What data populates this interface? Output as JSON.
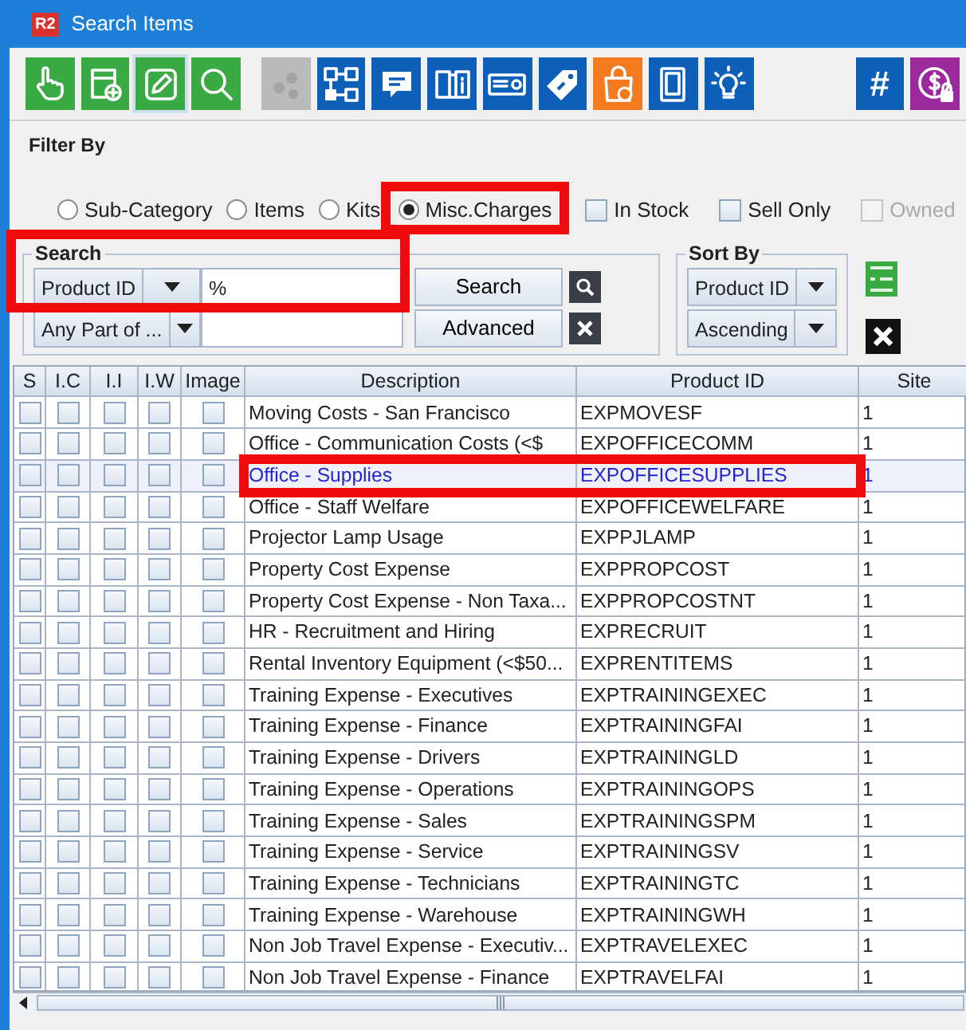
{
  "window": {
    "title": "Search Items",
    "logo": "R2"
  },
  "toolbar": [
    {
      "color": "#3aaa45",
      "selected": false,
      "disabled": false
    },
    {
      "color": "#3aaa45",
      "selected": false,
      "disabled": false
    },
    {
      "color": "#3aaa45",
      "selected": true,
      "disabled": false
    },
    {
      "color": "#3aaa45",
      "selected": false,
      "disabled": false
    },
    {
      "color": "#a8a8a8",
      "selected": false,
      "disabled": true
    },
    {
      "color": "#0d5fb8",
      "selected": false,
      "disabled": false
    },
    {
      "color": "#0d5fb8",
      "selected": false,
      "disabled": false
    },
    {
      "color": "#0d5fb8",
      "selected": false,
      "disabled": false
    },
    {
      "color": "#0d5fb8",
      "selected": false,
      "disabled": false
    },
    {
      "color": "#0d5fb8",
      "selected": false,
      "disabled": false
    },
    {
      "color": "#f47a20",
      "selected": false,
      "disabled": false
    },
    {
      "color": "#0d5fb8",
      "selected": false,
      "disabled": false
    },
    {
      "color": "#0d5fb8",
      "selected": false,
      "disabled": false
    },
    {
      "color": "#0d5fb8",
      "selected": false,
      "disabled": false,
      "label": "#"
    },
    {
      "color": "#9a2a9c",
      "selected": false,
      "disabled": false
    }
  ],
  "filter": {
    "title": "Filter By",
    "radios": [
      {
        "label": "Sub-Category",
        "selected": false,
        "highlighted": false
      },
      {
        "label": "Items",
        "selected": false,
        "highlighted": false
      },
      {
        "label": "Kits",
        "selected": false,
        "highlighted": false
      },
      {
        "label": "Misc.Charges",
        "selected": true,
        "highlighted": true
      }
    ],
    "checkboxes": [
      {
        "label": "In Stock",
        "checked": false,
        "disabled": false
      },
      {
        "label": "Sell Only",
        "checked": false,
        "disabled": false
      },
      {
        "label": "Owned",
        "checked": false,
        "disabled": true
      }
    ]
  },
  "search": {
    "title": "Search",
    "highlighted": true,
    "field": "Product ID",
    "value": "%",
    "match": "Any Part of ...",
    "search_button": "Search",
    "advanced_button": "Advanced"
  },
  "sort": {
    "title": "Sort By",
    "field": "Product ID",
    "order": "Ascending"
  },
  "table": {
    "columns": [
      "S",
      "I.C",
      "I.I",
      "I.W",
      "Image",
      "Description",
      "Product ID",
      "Site"
    ],
    "rows": [
      {
        "flags": [
          false,
          false,
          false,
          false,
          false
        ],
        "description": "Moving Costs - San Francisco",
        "product_id": "EXPMOVESF",
        "site": "1",
        "selected": false,
        "highlighted": false
      },
      {
        "flags": [
          false,
          false,
          false,
          false,
          false
        ],
        "description": "Office - Communication Costs (<$",
        "product_id": "EXPOFFICECOMM",
        "site": "1",
        "selected": false,
        "highlighted": false
      },
      {
        "flags": [
          false,
          false,
          false,
          false,
          false
        ],
        "description": "Office - Supplies",
        "product_id": "EXPOFFICESUPPLIES",
        "site": "1",
        "selected": true,
        "highlighted": true
      },
      {
        "flags": [
          false,
          false,
          false,
          false,
          false
        ],
        "description": "Office - Staff Welfare",
        "product_id": "EXPOFFICEWELFARE",
        "site": "1",
        "selected": false,
        "highlighted": false
      },
      {
        "flags": [
          false,
          false,
          false,
          false,
          false
        ],
        "description": "Projector Lamp Usage",
        "product_id": "EXPPJLAMP",
        "site": "1",
        "selected": false,
        "highlighted": false
      },
      {
        "flags": [
          false,
          false,
          false,
          false,
          false
        ],
        "description": "Property Cost Expense",
        "product_id": "EXPPROPCOST",
        "site": "1",
        "selected": false,
        "highlighted": false
      },
      {
        "flags": [
          false,
          false,
          false,
          false,
          false
        ],
        "description": "Property Cost Expense - Non Taxa...",
        "product_id": "EXPPROPCOSTNT",
        "site": "1",
        "selected": false,
        "highlighted": false
      },
      {
        "flags": [
          false,
          false,
          false,
          false,
          false
        ],
        "description": "HR - Recruitment and Hiring",
        "product_id": "EXPRECRUIT",
        "site": "1",
        "selected": false,
        "highlighted": false
      },
      {
        "flags": [
          false,
          false,
          false,
          false,
          false
        ],
        "description": "Rental Inventory Equipment (<$50...",
        "product_id": "EXPRENTITEMS",
        "site": "1",
        "selected": false,
        "highlighted": false
      },
      {
        "flags": [
          false,
          false,
          false,
          false,
          false
        ],
        "description": "Training Expense - Executives",
        "product_id": "EXPTRAININGEXEC",
        "site": "1",
        "selected": false,
        "highlighted": false
      },
      {
        "flags": [
          false,
          false,
          false,
          false,
          false
        ],
        "description": "Training Expense - Finance",
        "product_id": "EXPTRAININGFAI",
        "site": "1",
        "selected": false,
        "highlighted": false
      },
      {
        "flags": [
          false,
          false,
          false,
          false,
          false
        ],
        "description": "Training Expense - Drivers",
        "product_id": "EXPTRAININGLD",
        "site": "1",
        "selected": false,
        "highlighted": false
      },
      {
        "flags": [
          false,
          false,
          false,
          false,
          false
        ],
        "description": "Training Expense - Operations",
        "product_id": "EXPTRAININGOPS",
        "site": "1",
        "selected": false,
        "highlighted": false
      },
      {
        "flags": [
          false,
          false,
          false,
          false,
          false
        ],
        "description": "Training Expense - Sales",
        "product_id": "EXPTRAININGSPM",
        "site": "1",
        "selected": false,
        "highlighted": false
      },
      {
        "flags": [
          false,
          false,
          false,
          false,
          false
        ],
        "description": "Training Expense - Service",
        "product_id": "EXPTRAININGSV",
        "site": "1",
        "selected": false,
        "highlighted": false
      },
      {
        "flags": [
          false,
          false,
          false,
          false,
          false
        ],
        "description": "Training Expense - Technicians",
        "product_id": "EXPTRAININGTC",
        "site": "1",
        "selected": false,
        "highlighted": false
      },
      {
        "flags": [
          false,
          false,
          false,
          false,
          false
        ],
        "description": "Training Expense - Warehouse",
        "product_id": "EXPTRAININGWH",
        "site": "1",
        "selected": false,
        "highlighted": false
      },
      {
        "flags": [
          false,
          false,
          false,
          false,
          false
        ],
        "description": "Non Job Travel Expense - Executiv...",
        "product_id": "EXPTRAVELEXEC",
        "site": "1",
        "selected": false,
        "highlighted": false
      },
      {
        "flags": [
          false,
          false,
          false,
          false,
          false
        ],
        "description": "Non Job Travel Expense - Finance",
        "product_id": "EXPTRAVELFAI",
        "site": "1",
        "selected": false,
        "highlighted": false
      }
    ]
  }
}
